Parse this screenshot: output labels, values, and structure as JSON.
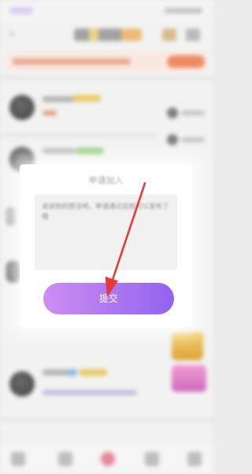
{
  "dialog": {
    "title": "申请加入",
    "textarea_placeholder": "说说你的想法吧，申请通过后就可以发布了哦",
    "submit_label": "提交"
  },
  "annotation": {
    "arrow_color": "#e53a3a"
  },
  "colors": {
    "button_gradient_start": "#cc8ef2",
    "button_gradient_end": "#9263ee"
  }
}
